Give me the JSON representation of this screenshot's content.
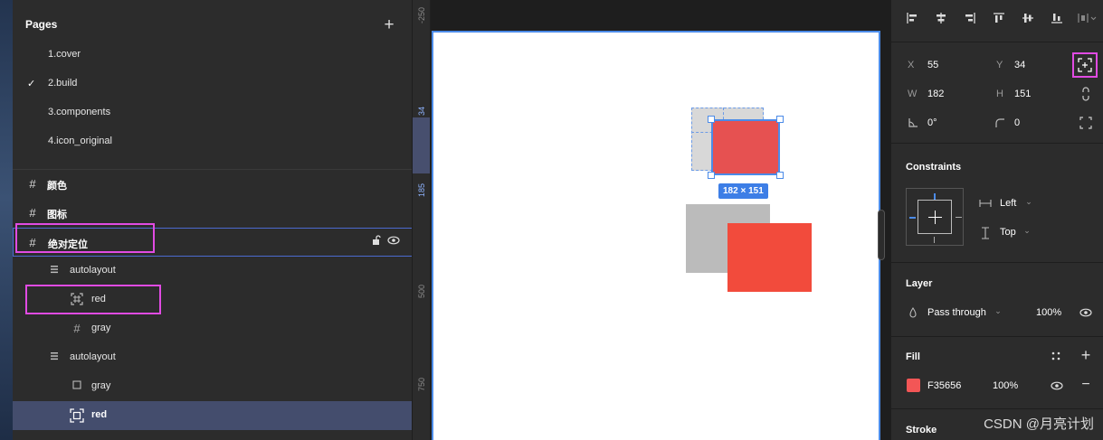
{
  "pages_header": "Pages",
  "pages": [
    "1.cover",
    "2.build",
    "3.components",
    "4.icon_original"
  ],
  "checkmark": "✓",
  "layers": [
    {
      "label": "颜色",
      "icon": "frame-hash-icon"
    },
    {
      "label": "图标",
      "icon": "frame-hash-icon"
    },
    {
      "label": "绝对定位",
      "icon": "frame-hash-icon"
    },
    {
      "label": "autolayout",
      "icon": "autolayout-icon"
    },
    {
      "label": "red",
      "icon": "absolute-frame-icon"
    },
    {
      "label": "gray",
      "icon": "frame-hash-icon"
    },
    {
      "label": "autolayout",
      "icon": "autolayout-icon"
    },
    {
      "label": "gray",
      "icon": "rectangle-icon"
    },
    {
      "label": "red",
      "icon": "absolute-frame-icon"
    }
  ],
  "ruler": {
    "labels": [
      "-250",
      "34",
      "185",
      "500",
      "750"
    ]
  },
  "canvas": {
    "size_badge": "182 × 151"
  },
  "properties": {
    "x_label": "X",
    "x": "55",
    "y_label": "Y",
    "y": "34",
    "w_label": "W",
    "w": "182",
    "h_label": "H",
    "h": "151",
    "rotation": "0°",
    "radius": "0"
  },
  "constraints": {
    "title": "Constraints",
    "horizontal": "Left",
    "vertical": "Top"
  },
  "layer": {
    "title": "Layer",
    "blend": "Pass through",
    "opacity": "100%"
  },
  "fill": {
    "title": "Fill",
    "hex": "F35656",
    "opacity": "100%",
    "swatch_color": "#F35656"
  },
  "stroke": {
    "title": "Stroke"
  },
  "watermark": "CSDN @月亮计划",
  "colors": {
    "selection": "#4b8be8",
    "highlight": "#e14be3",
    "selected_row": "#444d6d"
  }
}
